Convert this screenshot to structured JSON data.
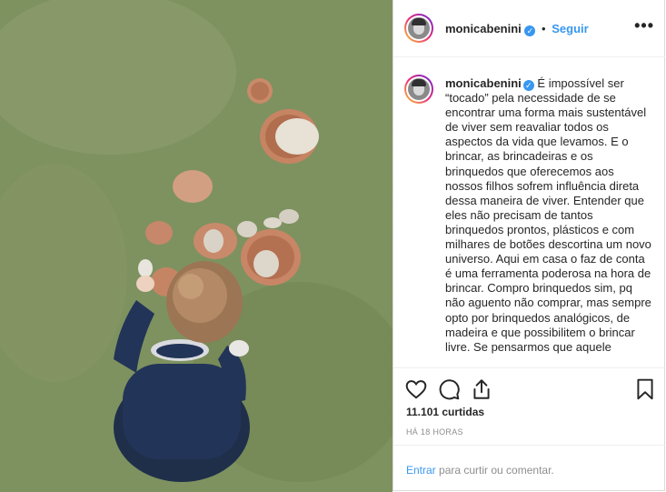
{
  "post": {
    "image_alt": "child playing with clay pots on grass",
    "username": "monicabenini",
    "verified_icon": "verified-badge-icon",
    "separator": "•",
    "follow_label": "Seguir",
    "more_icon": "more-options-icon",
    "caption": "É impossível ser “tocado” pela necessidade de se encontrar uma forma mais sustentável de viver sem reavaliar todos os aspectos da vida que levamos. E o brincar, as brincadeiras e os brinquedos que oferecemos aos nossos filhos sofrem influência direta dessa maneira de viver. Entender que eles não precisam de tantos brinquedos prontos, plásticos e com milhares de botões descortina um novo universo. Aqui em casa o faz de conta é uma ferramenta poderosa na hora de brincar. Compro brinquedos sim, pq não aguento não comprar, mas sempre opto por brinquedos analógicos, de madeira e que possibilitem o brincar livre. Se pensarmos que aquele",
    "likes": "11.101 curtidas",
    "time": "HÁ 18 HORAS",
    "footer": {
      "login_link": "Entrar",
      "rest": " para curtir ou comentar."
    }
  },
  "icons": [
    "heart-icon",
    "comment-icon",
    "share-icon",
    "bookmark-icon"
  ],
  "colors": {
    "link": "#3897f0",
    "text": "#262626",
    "muted": "#8e8e8e",
    "border": "#dbdbdb"
  }
}
